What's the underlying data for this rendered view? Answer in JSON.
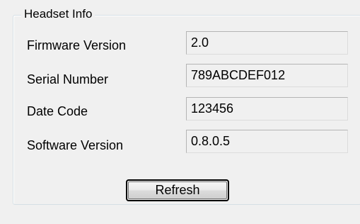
{
  "group": {
    "title": "Headset Info"
  },
  "fields": [
    {
      "label": "Firmware Version",
      "value": "2.0"
    },
    {
      "label": "Serial Number",
      "value": "789ABCDEF012"
    },
    {
      "label": "Date Code",
      "value": "123456"
    },
    {
      "label": "Software Version",
      "value": "0.8.0.5"
    }
  ],
  "buttons": {
    "refresh_label": "Refresh"
  }
}
